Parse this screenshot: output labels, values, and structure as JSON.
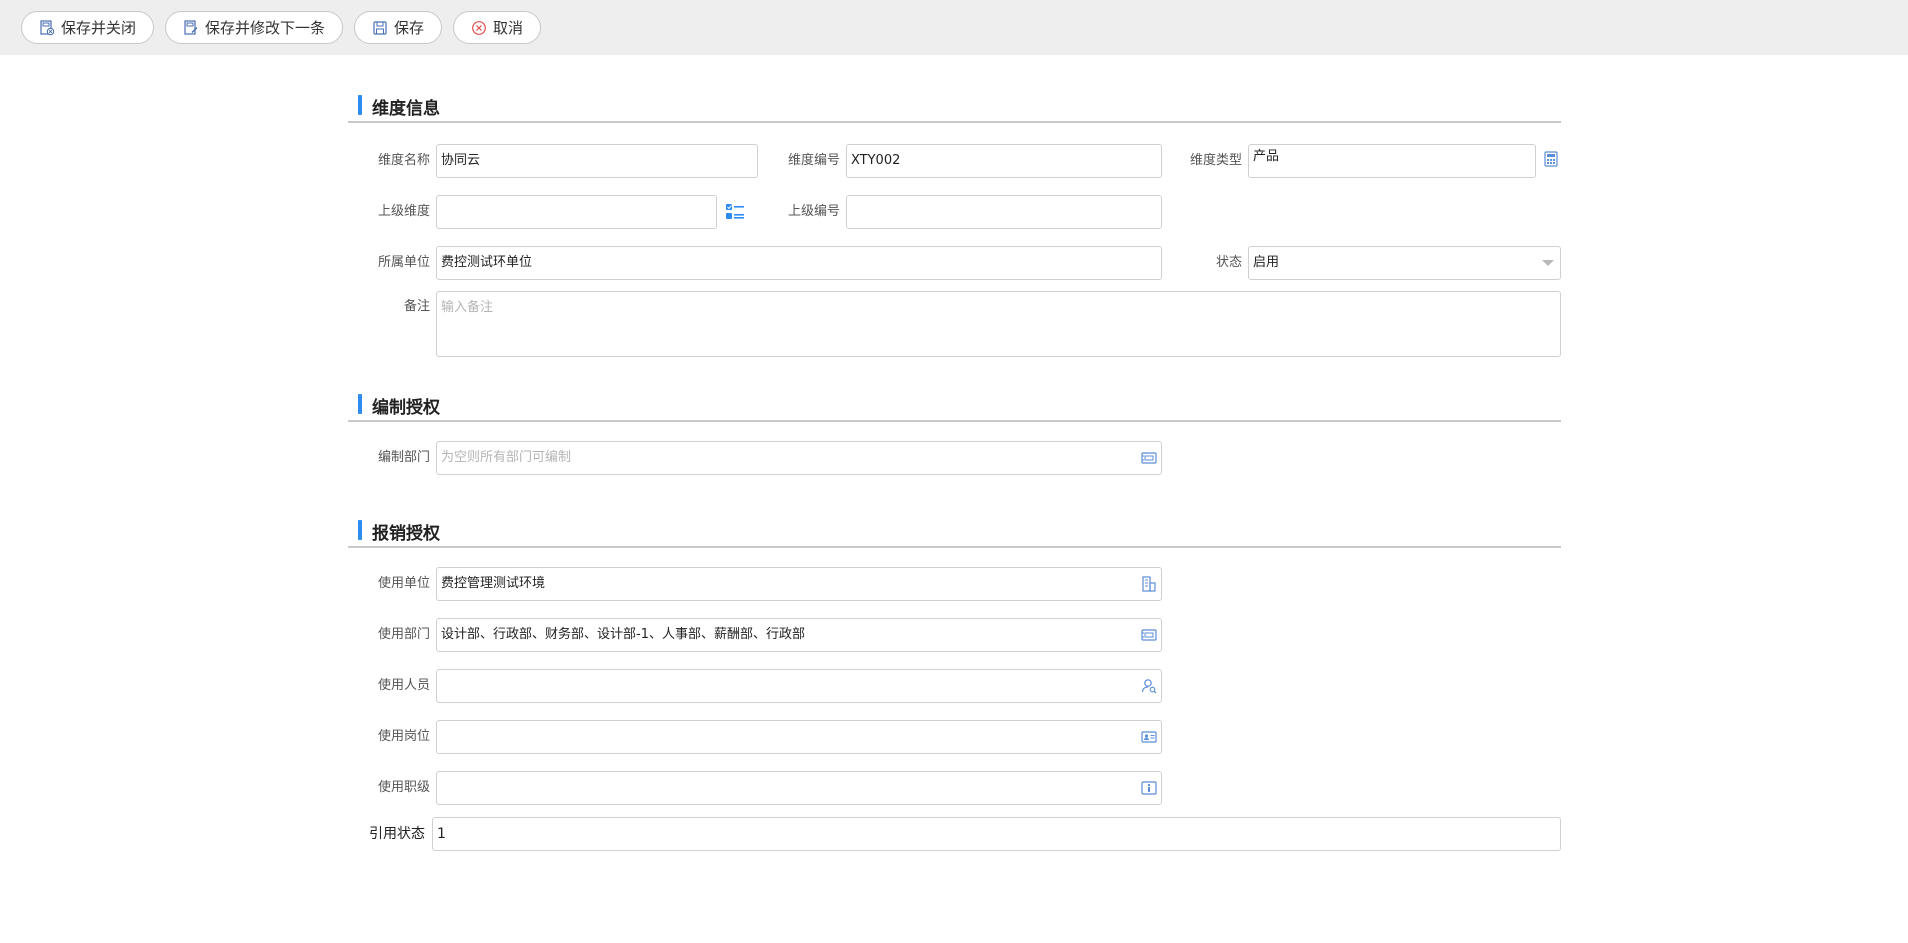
{
  "toolbar": {
    "save_close": "保存并关闭",
    "save_next": "保存并修改下一条",
    "save": "保存",
    "cancel": "取消"
  },
  "sections": {
    "dimension_info": "维度信息",
    "edit_auth": "编制授权",
    "reimburse_auth": "报销授权"
  },
  "dimension": {
    "name_label": "维度名称",
    "name_value": "协同云",
    "code_label": "维度编号",
    "code_value": "XTY002",
    "type_label": "维度类型",
    "type_value": "产品",
    "parent_label": "上级维度",
    "parent_value": "",
    "parent_code_label": "上级编号",
    "parent_code_value": "",
    "unit_label": "所属单位",
    "unit_value": "费控测试环单位",
    "status_label": "状态",
    "status_value": "启用",
    "remark_label": "备注",
    "remark_placeholder": "输入备注"
  },
  "edit": {
    "dept_label": "编制部门",
    "dept_placeholder": "为空则所有部门可编制"
  },
  "reimburse": {
    "unit_label": "使用单位",
    "unit_value": "费控管理测试环境",
    "dept_label": "使用部门",
    "dept_value": "设计部、行政部、财务部、设计部-1、人事部、薪酬部、行政部",
    "person_label": "使用人员",
    "person_value": "",
    "post_label": "使用岗位",
    "post_value": "",
    "rank_label": "使用职级",
    "rank_value": "",
    "ref_label": "引用状态",
    "ref_value": "1"
  },
  "icons": {
    "accent": "#2d8cf0",
    "icon_blue": "#5b8ed8",
    "cancel_red": "#e05050"
  }
}
